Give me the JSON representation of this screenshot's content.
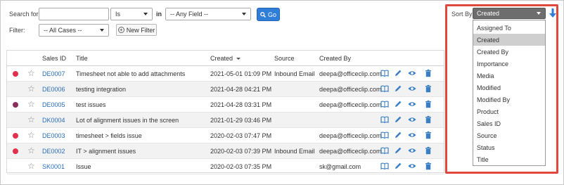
{
  "search": {
    "label": "Search for:",
    "value": "",
    "operator": "Is",
    "in_label": "in",
    "field": "-- Any Field --",
    "go_label": "Go"
  },
  "filter": {
    "label": "Filter:",
    "value": "-- All Cases --",
    "new_filter_label": "New Filter"
  },
  "table": {
    "columns": {
      "sales_id": "Sales ID",
      "title": "Title",
      "created": "Created",
      "source": "Source",
      "created_by": "Created By"
    },
    "rows": [
      {
        "status_color": "#e0304a",
        "id": "DE0007",
        "title": "Timesheet not able to add attachments",
        "created": "2021-05-01 01:09 PM",
        "source": "Inbound Email",
        "created_by": "deepa@officeclip.com"
      },
      {
        "status_color": "",
        "id": "DE0006",
        "title": "testing integration",
        "created": "2021-04-28 04:21 PM",
        "source": "",
        "created_by": "deepa@officeclip.com"
      },
      {
        "status_color": "#8b2e5a",
        "id": "DE0005",
        "title": "test issues",
        "created": "2021-04-28 03:31 PM",
        "source": "",
        "created_by": "deepa@officeclip.com"
      },
      {
        "status_color": "",
        "id": "DK0004",
        "title": "Lot of alignment issues in the screen",
        "created": "2021-01-29 03:46 PM",
        "source": "",
        "created_by": ""
      },
      {
        "status_color": "#e0304a",
        "id": "DE0003",
        "title": "timesheet > fields issue",
        "created": "2020-02-03 07:47 PM",
        "source": "",
        "created_by": "deepa@officeclip.com"
      },
      {
        "status_color": "#e0304a",
        "id": "DE0002",
        "title": "IT > alignment issues",
        "created": "2020-02-03 07:39 PM",
        "source": "Inbound Email",
        "created_by": "deepa@officeclip.com"
      },
      {
        "status_color": "",
        "id": "SK0001",
        "title": "Issue",
        "created": "2020-02-03 07:35 PM",
        "source": "",
        "created_by": "sk@gmail.com"
      }
    ]
  },
  "sort": {
    "label": "Sort By:",
    "selected": "Created",
    "options": [
      "Assigned To",
      "Created",
      "Created By",
      "Importance",
      "Media",
      "Modified",
      "Modified By",
      "Product",
      "Sales ID",
      "Source",
      "Status",
      "Title"
    ],
    "selected_index": 1
  },
  "colors": {
    "accent": "#2f7ed8",
    "link": "#2a6ebb",
    "highlight": "#e0473f"
  },
  "icons": [
    "book-icon",
    "pencil-icon",
    "eye-icon",
    "trash-icon",
    "star-icon",
    "search-icon",
    "plus-icon",
    "sort-arrow-down-icon"
  ]
}
